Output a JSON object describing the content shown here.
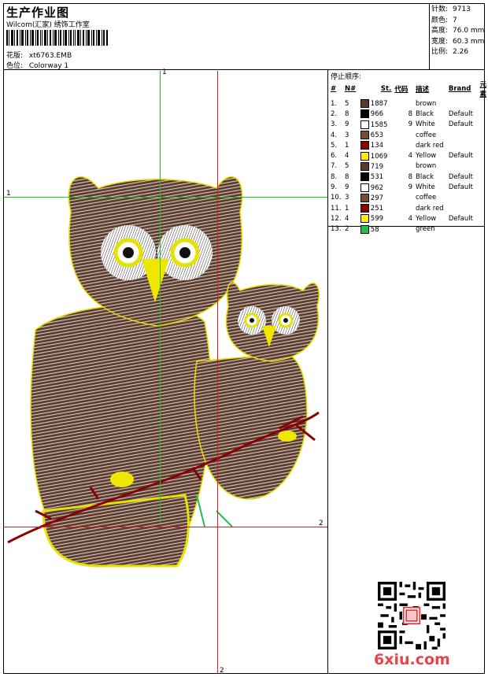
{
  "header": {
    "title": "生产作业图",
    "company": "Wilcom(汇家) 绣饰工作室",
    "design_label": "花版:",
    "design_value": "xt6763.EMB",
    "colorway_label": "色位:",
    "colorway_value": "Colorway 1"
  },
  "stats": [
    {
      "label": "针数:",
      "value": "9713"
    },
    {
      "label": "颜色:",
      "value": "7"
    },
    {
      "label": "高度:",
      "value": "76.0 mm"
    },
    {
      "label": "宽度:",
      "value": "60.3 mm"
    },
    {
      "label": "比例:",
      "value": "2.26"
    }
  ],
  "stop_sequence": {
    "title": "停止顺序:",
    "headers": [
      "#",
      "N#",
      "St.",
      "代码",
      "描述",
      "Brand",
      "元素"
    ],
    "rows": [
      {
        "idx": "1.",
        "n": "5",
        "color": "#5a3a2a",
        "st": "1887",
        "code": "",
        "desc": "brown",
        "brand": ""
      },
      {
        "idx": "2.",
        "n": "8",
        "color": "#000000",
        "st": "966",
        "code": "8",
        "desc": "Black",
        "brand": "Default"
      },
      {
        "idx": "3.",
        "n": "9",
        "color": "#ffffff",
        "st": "1585",
        "code": "9",
        "desc": "White",
        "brand": "Default"
      },
      {
        "idx": "4.",
        "n": "3",
        "color": "#7a4a34",
        "st": "653",
        "code": "",
        "desc": "coffee",
        "brand": ""
      },
      {
        "idx": "5.",
        "n": "1",
        "color": "#8b0000",
        "st": "134",
        "code": "",
        "desc": "dark red",
        "brand": ""
      },
      {
        "idx": "6.",
        "n": "4",
        "color": "#ffee00",
        "st": "1069",
        "code": "4",
        "desc": "Yellow",
        "brand": "Default"
      },
      {
        "idx": "7.",
        "n": "5",
        "color": "#5a3a2a",
        "st": "719",
        "code": "",
        "desc": "brown",
        "brand": ""
      },
      {
        "idx": "8.",
        "n": "8",
        "color": "#000000",
        "st": "531",
        "code": "8",
        "desc": "Black",
        "brand": "Default"
      },
      {
        "idx": "9.",
        "n": "9",
        "color": "#ffffff",
        "st": "962",
        "code": "9",
        "desc": "White",
        "brand": "Default"
      },
      {
        "idx": "10.",
        "n": "3",
        "color": "#7a4a34",
        "st": "297",
        "code": "",
        "desc": "coffee",
        "brand": ""
      },
      {
        "idx": "11.",
        "n": "1",
        "color": "#8b0000",
        "st": "251",
        "code": "",
        "desc": "dark red",
        "brand": ""
      },
      {
        "idx": "12.",
        "n": "4",
        "color": "#ffee00",
        "st": "599",
        "code": "4",
        "desc": "Yellow",
        "brand": "Default"
      },
      {
        "idx": "13.",
        "n": "2",
        "color": "#1ec24a",
        "st": "58",
        "code": "",
        "desc": "green",
        "brand": ""
      }
    ]
  },
  "guides": {
    "green_v_label": "1",
    "green_h_label": "1",
    "red_h_label": "2",
    "red_v_label": "2"
  },
  "watermark": "6xiu.com"
}
